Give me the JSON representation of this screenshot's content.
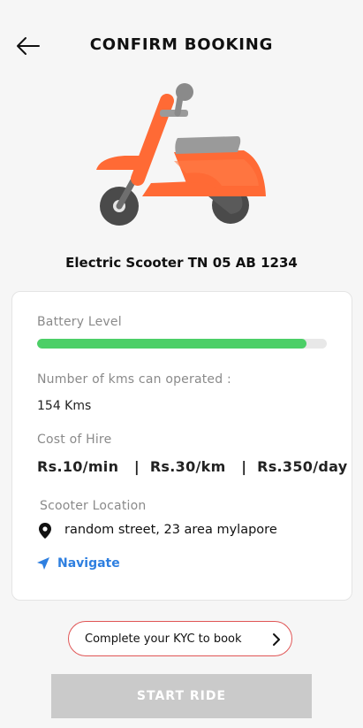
{
  "header": {
    "title": "CONFIRM BOOKING",
    "back_icon": "arrow-left-icon"
  },
  "vehicle": {
    "image_icon": "scooter-illustration",
    "name": "Electric Scooter TN 05 AB 1234",
    "image_colors": {
      "body": "#ff6a35",
      "dark": "#4a4a4a",
      "seat": "#9a9a9a"
    }
  },
  "details": {
    "battery": {
      "label": "Battery Level",
      "level_percent": 93,
      "color": "#4ccf67"
    },
    "range": {
      "label": "Number of kms can operated :",
      "value": "154 Kms"
    },
    "cost": {
      "label": "Cost of Hire",
      "per_min": "Rs.10/min",
      "per_km": "Rs.30/km",
      "per_day": "Rs.350/day",
      "separator": "|"
    },
    "location": {
      "label": "Scooter Location",
      "address": "random street, 23 area mylapore",
      "icon": "map-pin-icon"
    },
    "navigate": {
      "label": "Navigate",
      "icon": "navigation-arrow-icon",
      "color": "#2e7fe0"
    }
  },
  "kyc": {
    "label": "Complete your KYC to book",
    "icon": "chevron-right-icon",
    "border_color": "#e05555"
  },
  "start_ride": {
    "label": "START RIDE",
    "enabled": false,
    "color": "#cacaca"
  }
}
